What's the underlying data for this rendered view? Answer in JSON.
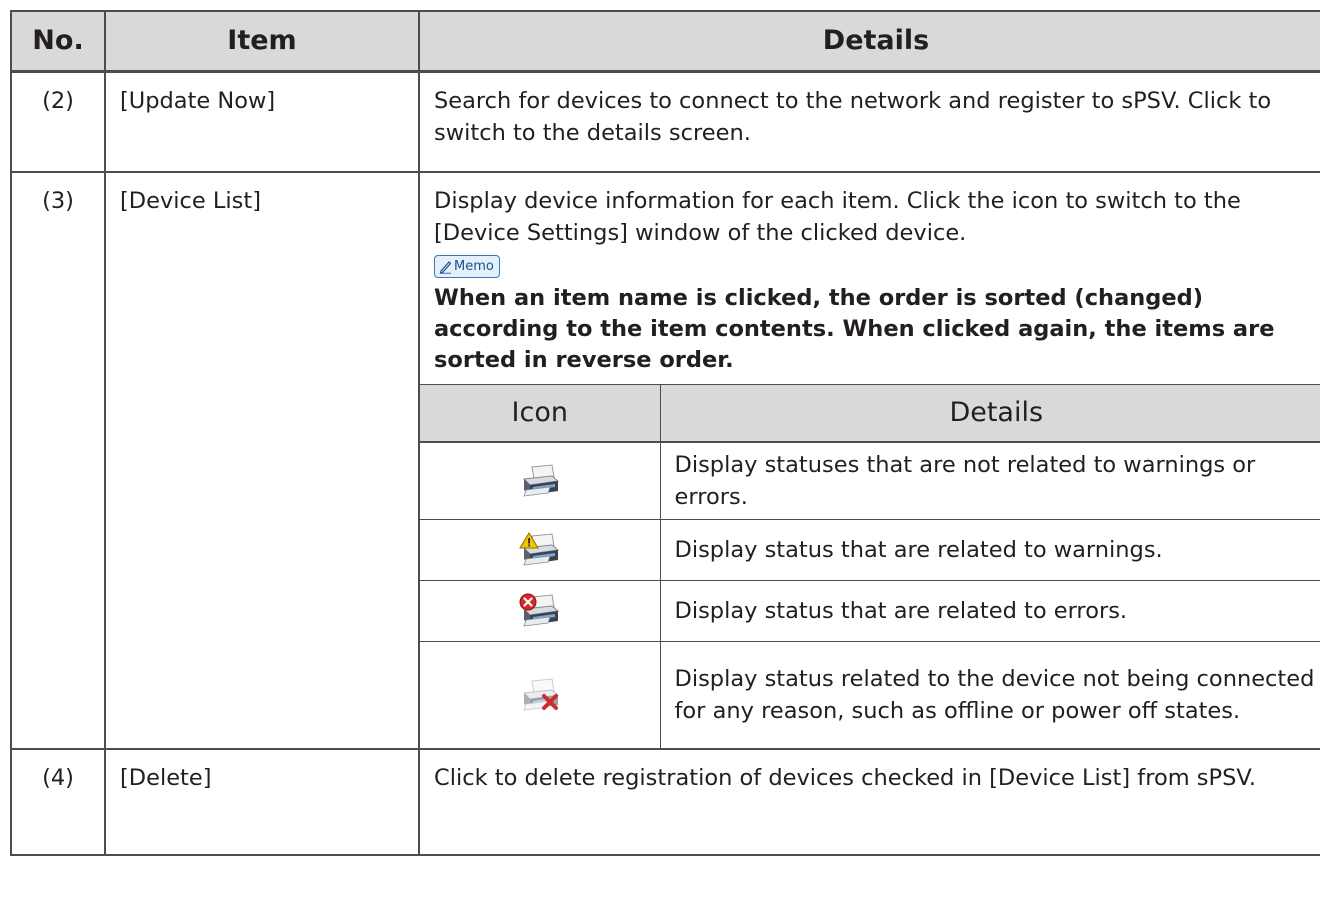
{
  "table": {
    "headers": {
      "no": "No.",
      "item": "Item",
      "details": "Details"
    },
    "rows": [
      {
        "no": "(2)",
        "item": "[Update Now]",
        "details": "Search for devices to connect to the network and register to sPSV. Click to switch to the details screen."
      },
      {
        "no": "(3)",
        "item": "[Device List]",
        "details": "Display device information for each item. Click the icon to switch to the [Device Settings] window of the clicked device.",
        "memo_label": "Memo",
        "memo_text": "When an item name is clicked, the order is sorted (changed) according to the item contents. When clicked again, the items are sorted in reverse order.",
        "icon_table": {
          "headers": {
            "icon": "Icon",
            "details": "Details"
          },
          "rows": [
            {
              "icon": "printer-normal-icon",
              "details": "Display statuses that are not related to warnings or errors."
            },
            {
              "icon": "printer-warning-icon",
              "details": "Display status that are related to warnings."
            },
            {
              "icon": "printer-error-icon",
              "details": "Display status that are related to errors."
            },
            {
              "icon": "printer-offline-icon",
              "details": "Display status related to the device not being connected for any reason, such as offline or power off states."
            }
          ]
        }
      },
      {
        "no": "(4)",
        "item": "[Delete]",
        "details": "Click to delete registration of devices checked in [Device List] from sPSV."
      }
    ]
  }
}
